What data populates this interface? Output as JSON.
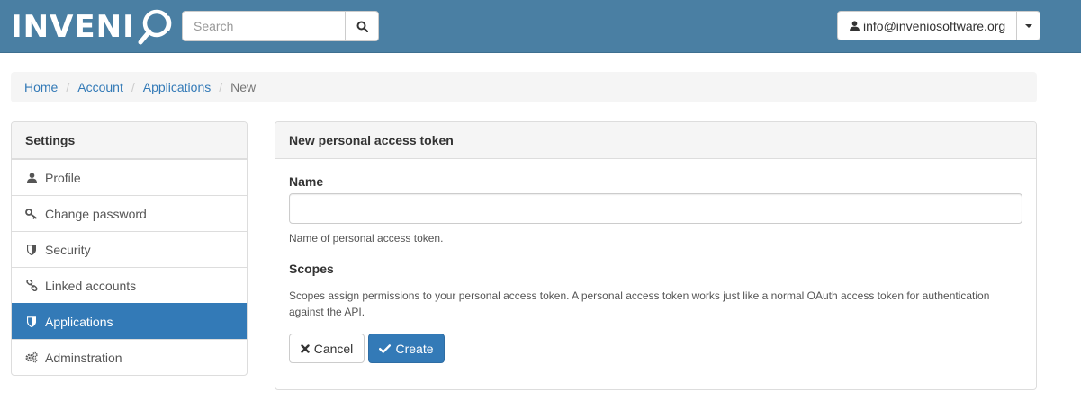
{
  "brand": {
    "logo_text": "INVENI"
  },
  "search": {
    "placeholder": "Search"
  },
  "user_menu": {
    "email": "info@inveniosoftware.org"
  },
  "breadcrumb": {
    "items": [
      "Home",
      "Account",
      "Applications"
    ],
    "current": "New",
    "separator": "/"
  },
  "sidebar": {
    "heading": "Settings",
    "items": [
      {
        "label": "Profile",
        "icon": "user-icon"
      },
      {
        "label": "Change password",
        "icon": "key-icon"
      },
      {
        "label": "Security",
        "icon": "shield-icon"
      },
      {
        "label": "Linked accounts",
        "icon": "link-icon"
      },
      {
        "label": "Applications",
        "icon": "shield-icon",
        "active": true
      },
      {
        "label": "Adminstration",
        "icon": "cogs-icon"
      }
    ]
  },
  "panel": {
    "heading": "New personal access token",
    "name_label": "Name",
    "name_value": "",
    "name_help": "Name of personal access token.",
    "scopes_label": "Scopes",
    "scopes_help": "Scopes assign permissions to your personal access token. A personal access token works just like a normal OAuth access token for authentication against the API.",
    "cancel_label": "Cancel",
    "create_label": "Create"
  },
  "colors": {
    "navbar": "#4a7fa3",
    "primary": "#337ab7",
    "link": "#337ab7"
  }
}
